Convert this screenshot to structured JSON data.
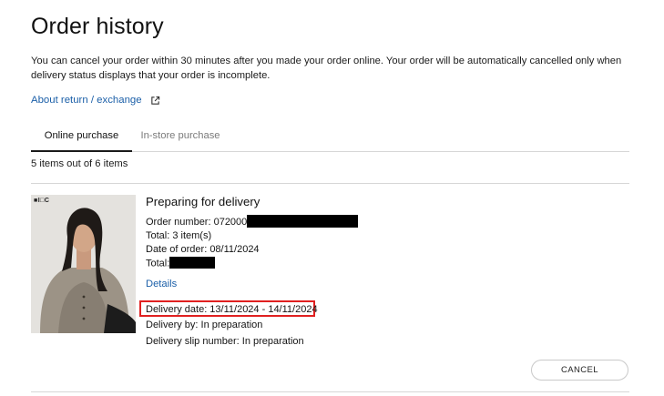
{
  "page": {
    "title": "Order history",
    "notice": "You can cancel your order within 30 minutes after you made your order online. Your order will be automatically cancelled only when delivery status displays that your order is incomplete.",
    "return_link": "About return / exchange",
    "return_link_icon": "external-link-icon"
  },
  "tabs": [
    {
      "label": "Online purchase",
      "active": true
    },
    {
      "label": "In-store purchase",
      "active": false
    }
  ],
  "item_count": "5 items out of 6 items",
  "order": {
    "image_brand": "■I□C",
    "status": "Preparing for delivery",
    "order_number_label": "Order number: 072000",
    "total_items": "Total: 3 item(s)",
    "date_of_order": "Date of order: 08/11/2024",
    "total_label": "Total:",
    "details_link": "Details",
    "delivery_date": "Delivery date: 13/11/2024 - 14/11/2024",
    "delivery_by": "Delivery by: In preparation",
    "delivery_slip": "Delivery slip number: In preparation",
    "cancel_label": "CANCEL"
  },
  "colors": {
    "link": "#1b5fa8",
    "highlight_border": "#e02020",
    "redaction": "#000000"
  }
}
